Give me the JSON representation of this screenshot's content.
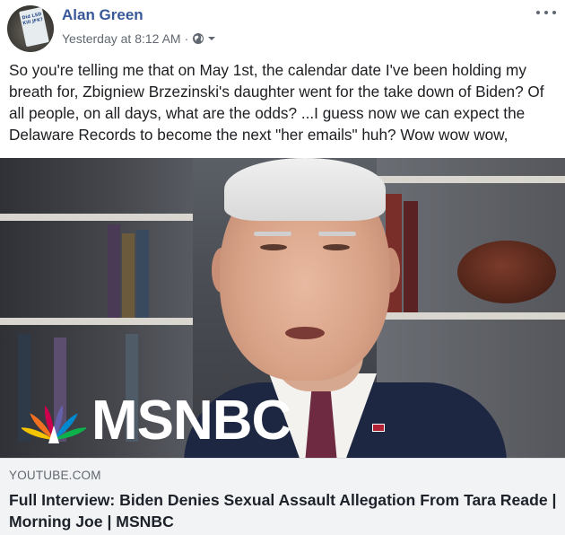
{
  "post": {
    "author": "Alan Green",
    "timestamp": "Yesterday at 8:12 AM",
    "separator": "·",
    "privacy_icon": "globe-icon",
    "more_icon": "more-horizontal-icon",
    "avatar_text": "Did LSD Kill JFK?",
    "text": "So you're telling me that on May 1st, the calendar date I've been holding my breath for, Zbigniew Brzezinski's daughter went for the take down of Biden? Of all people, on all days, what are the odds? ...I guess now we can expect the Delaware Records to become the next \"her emails\" huh? Wow wow wow,"
  },
  "media": {
    "logo_text": "MSNBC",
    "logo_icon": "peacock-icon",
    "peacock_colors": [
      "#f4c400",
      "#f37021",
      "#cc004c",
      "#6460aa",
      "#0089d0",
      "#0db14b"
    ]
  },
  "link_preview": {
    "domain": "YOUTUBE.COM",
    "title": "Full Interview: Biden Denies Sexual Assault Allegation From Tara Reade | Morning Joe | MSNBC"
  },
  "colors": {
    "author": "#385898",
    "meta": "#606770",
    "link_bg": "#f2f3f5"
  }
}
